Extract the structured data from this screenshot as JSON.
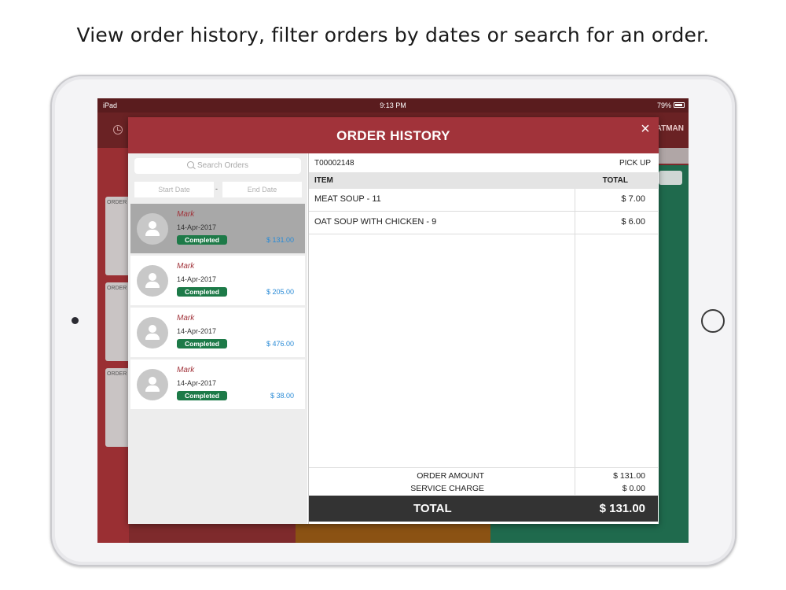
{
  "caption": "View order history, filter orders by dates or search for an order.",
  "status_bar": {
    "device": "iPad",
    "time": "9:13 PM",
    "battery": "79%"
  },
  "header": {
    "user_fragment": "ATMAN"
  },
  "background": {
    "order_card_label": "ORDER"
  },
  "modal": {
    "title": "ORDER HISTORY",
    "close_label": "×",
    "search": {
      "placeholder": "Search Orders"
    },
    "date_filter": {
      "start_placeholder": "Start Date",
      "separator": "-",
      "end_placeholder": "End Date"
    },
    "orders": [
      {
        "name": "Mark",
        "date": "14-Apr-2017",
        "status": "Completed",
        "amount": "$ 131.00",
        "selected": true
      },
      {
        "name": "Mark",
        "date": "14-Apr-2017",
        "status": "Completed",
        "amount": "$ 205.00",
        "selected": false
      },
      {
        "name": "Mark",
        "date": "14-Apr-2017",
        "status": "Completed",
        "amount": "$ 476.00",
        "selected": false
      },
      {
        "name": "Mark",
        "date": "14-Apr-2017",
        "status": "Completed",
        "amount": "$ 38.00",
        "selected": false
      }
    ],
    "detail": {
      "order_number": "T00002148",
      "order_type": "PICK UP",
      "columns": {
        "item": "ITEM",
        "total": "TOTAL"
      },
      "items": [
        {
          "name": "MEAT SOUP - 11",
          "price": "$ 7.00"
        },
        {
          "name": "OAT SOUP WITH CHICKEN - 9",
          "price": "$ 6.00"
        }
      ],
      "summary": {
        "order_amount_label": "ORDER AMOUNT",
        "order_amount": "$ 131.00",
        "service_charge_label": "SERVICE CHARGE",
        "service_charge": "$ 0.00",
        "total_label": "TOTAL",
        "total": "$ 131.00"
      }
    }
  },
  "colors": {
    "modal_header": "#a1333a",
    "status_completed": "#1d7a48",
    "amount_text": "#2a8bd6",
    "total_bar": "#333333"
  }
}
